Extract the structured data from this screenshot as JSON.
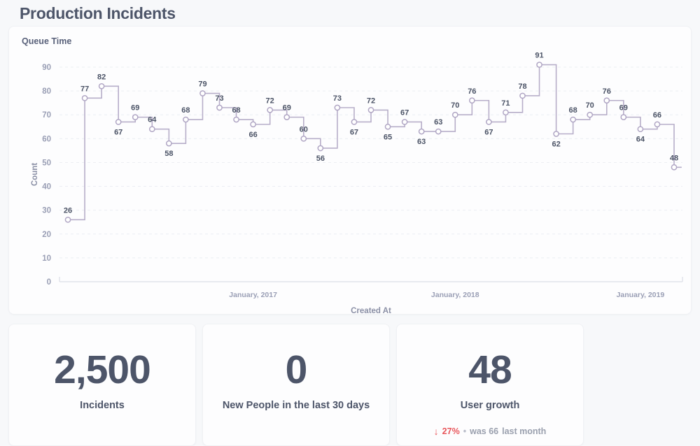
{
  "page": {
    "title": "Production Incidents"
  },
  "chart_card": {
    "legend_label": "Queue Time"
  },
  "chart_data": {
    "type": "line",
    "title": "Queue Time",
    "xlabel": "Created At",
    "ylabel": "Count",
    "ylim": [
      0,
      90
    ],
    "y_ticks": [
      0,
      10,
      20,
      30,
      40,
      50,
      60,
      70,
      80,
      90
    ],
    "x_tick_labels": [
      "January, 2017",
      "January, 2018",
      "January, 2019"
    ],
    "x_tick_positions": [
      11,
      23,
      34
    ],
    "grid": true,
    "legend_position": "top-left",
    "step": "post",
    "show_point_labels": true,
    "series": [
      {
        "name": "Queue Time",
        "color": "#b7aec9",
        "values": [
          26,
          77,
          82,
          67,
          69,
          64,
          58,
          68,
          79,
          73,
          68,
          66,
          72,
          69,
          60,
          56,
          73,
          67,
          72,
          65,
          67,
          63,
          63,
          70,
          76,
          67,
          71,
          78,
          91,
          62,
          68,
          70,
          76,
          69,
          64,
          66,
          48
        ]
      }
    ]
  },
  "stats": [
    {
      "value": "2,500",
      "label": "Incidents"
    },
    {
      "value": "0",
      "label": "New People in the last 30 days"
    },
    {
      "value": "48",
      "label": "User growth",
      "trend": {
        "arrow": "down-arrow-icon",
        "arrow_glyph": "↓",
        "percent": "27%",
        "separator": "•",
        "was": "was 66",
        "period": "last month",
        "color": "#e8575c"
      }
    }
  ]
}
